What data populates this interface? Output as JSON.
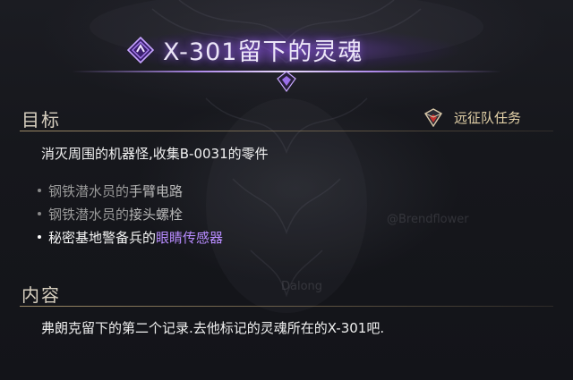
{
  "quest": {
    "title": "X-301留下的灵魂"
  },
  "objective": {
    "header": "目标",
    "quest_type": "远征队任务",
    "main": "消灭周围的机器怪,收集B-0031的零件",
    "sub_items": [
      {
        "prefix": "钢铁潜水员的",
        "target": "手臂电路",
        "status": "done"
      },
      {
        "prefix": "钢铁潜水员的",
        "target": "接头螺栓",
        "status": "done"
      },
      {
        "prefix": "秘密基地警备兵的",
        "target": "眼睛传感器",
        "status": "active"
      }
    ]
  },
  "content": {
    "header": "内容",
    "text": "弗朗克留下的第二个记录.去他标记的灵魂所在的X-301吧."
  },
  "watermarks": [
    "@Brendflower",
    "Dalong"
  ],
  "icons": {
    "title_icon": "purple-diamond-quest-icon",
    "expedition_icon": "expedition-crest-icon"
  },
  "colors": {
    "title_glow": "#8a4ee0",
    "highlight_text": "#b88cff",
    "header_text": "#d8d0c0",
    "expedition_text": "#e4d2a8",
    "underline": "#aa966e"
  }
}
